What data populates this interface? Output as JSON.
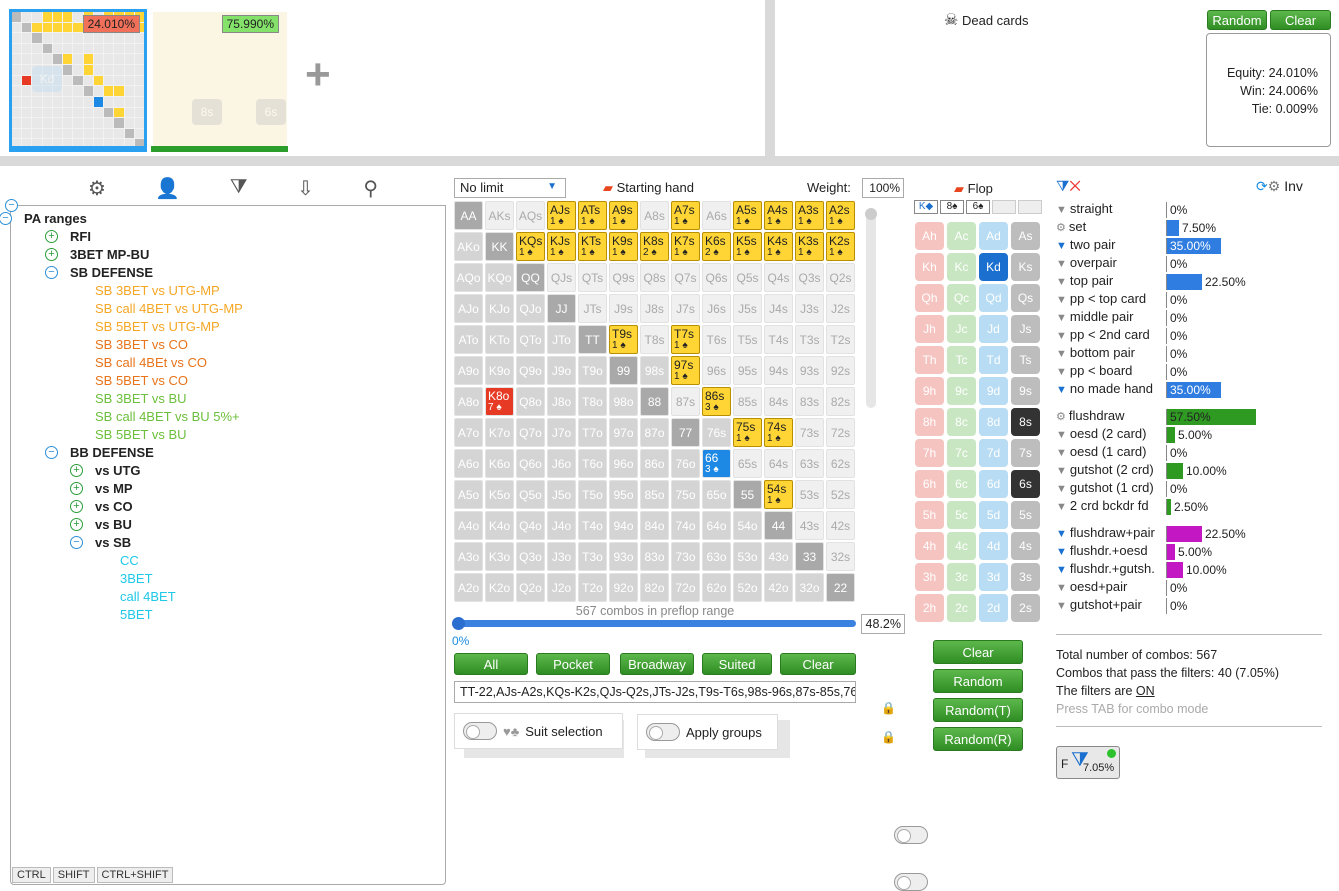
{
  "top": {
    "range_a_pct": "24.010%",
    "range_b_pct": "75.990%",
    "plus_label": "+"
  },
  "dead": {
    "title": "Dead cards",
    "skull": "☠",
    "rows": [
      [
        "Ah",
        "Kh",
        "Qh",
        "Jh",
        "Th",
        "9h",
        "8h",
        "7h",
        "6h",
        "5h",
        "4h",
        "3h",
        "2h"
      ],
      [
        "Ac",
        "Kc",
        "Qc",
        "Jc",
        "Tc",
        "9c",
        "8c",
        "7c",
        "6c",
        "5c",
        "4c",
        "3c",
        "2c"
      ],
      [
        "Ad",
        "Kd",
        "Qd",
        "Jd",
        "Td",
        "9d",
        "8d",
        "7d",
        "6d",
        "5d",
        "4d",
        "3d",
        "2d"
      ],
      [
        "As",
        "Ks",
        "Qs",
        "Js",
        "Ts",
        "9s",
        "8s",
        "7s",
        "6s",
        "5s",
        "4s",
        "3s",
        "2s"
      ]
    ],
    "random": "Random",
    "clear": "Clear",
    "equity": "Equity: 24.010%",
    "win": "Win: 24.006%",
    "tie": "Tie: 0.009%"
  },
  "toolbar": {
    "icons": [
      "gear-icon",
      "user-icon",
      "filter-add-icon",
      "import-icon",
      "search-icon"
    ],
    "glyphs": [
      "⚙",
      "👤",
      "⧩",
      "⇩",
      "⚲"
    ]
  },
  "tree": {
    "root": "PA ranges",
    "items": [
      {
        "label": "RFI",
        "lvl": 1,
        "bold": true,
        "exp": "+",
        "color": "#222"
      },
      {
        "label": "3BET MP-BU",
        "lvl": 1,
        "bold": true,
        "exp": "+",
        "color": "#222"
      },
      {
        "label": "SB DEFENSE",
        "lvl": 1,
        "bold": true,
        "exp": "-",
        "color": "#222"
      },
      {
        "label": "SB 3BET vs UTG-MP",
        "lvl": 2,
        "color": "#f5a623"
      },
      {
        "label": "SB call 4BET vs UTG-MP",
        "lvl": 2,
        "color": "#f5a623"
      },
      {
        "label": "SB 5BET vs UTG-MP",
        "lvl": 2,
        "color": "#f5a623"
      },
      {
        "label": "SB 3BET vs CO",
        "lvl": 2,
        "color": "#e8731a"
      },
      {
        "label": "SB call 4BEt vs CO",
        "lvl": 2,
        "color": "#e8731a"
      },
      {
        "label": "SB 5BET vs CO",
        "lvl": 2,
        "color": "#e8731a"
      },
      {
        "label": "SB 3BET vs BU",
        "lvl": 2,
        "color": "#6cbf3a"
      },
      {
        "label": "SB call 4BET vs BU 5%+",
        "lvl": 2,
        "color": "#6cbf3a"
      },
      {
        "label": "SB 5BET vs BU",
        "lvl": 2,
        "color": "#6cbf3a"
      },
      {
        "label": "BB DEFENSE",
        "lvl": 1,
        "bold": true,
        "exp": "-",
        "color": "#222"
      },
      {
        "label": "vs UTG",
        "lvl": 2,
        "bold": true,
        "exp": "+",
        "color": "#222"
      },
      {
        "label": "vs MP",
        "lvl": 2,
        "bold": true,
        "exp": "+",
        "color": "#222"
      },
      {
        "label": "vs CO",
        "lvl": 2,
        "bold": true,
        "exp": "+",
        "color": "#222"
      },
      {
        "label": "vs BU",
        "lvl": 2,
        "bold": true,
        "exp": "+",
        "color": "#222"
      },
      {
        "label": "vs SB",
        "lvl": 2,
        "bold": true,
        "exp": "-",
        "color": "#222"
      },
      {
        "label": "CC",
        "lvl": 3,
        "color": "#1ec8e8"
      },
      {
        "label": "3BET",
        "lvl": 3,
        "color": "#1ec8e8"
      },
      {
        "label": "call 4BET",
        "lvl": 3,
        "color": "#1ec8e8"
      },
      {
        "label": "5BET",
        "lvl": 3,
        "color": "#1ec8e8"
      }
    ],
    "keys": [
      "CTRL",
      "SHIFT",
      "CTRL+SHIFT"
    ]
  },
  "matrix": {
    "mode": "No limit",
    "starting": "Starting hand",
    "weight_label": "Weight:",
    "weight": "100%",
    "grid": [
      [
        "AA",
        "AKs",
        "AQs",
        "AJs|1",
        "ATs|1",
        "A9s|1",
        "A8s",
        "A7s|1",
        "A6s",
        "A5s|1",
        "A4s|1",
        "A3s|1",
        "A2s|1"
      ],
      [
        "AKo",
        "KK",
        "KQs|1",
        "KJs|1",
        "KTs|1",
        "K9s|1",
        "K8s|2",
        "K7s|1",
        "K6s|2",
        "K5s|1",
        "K4s|1",
        "K3s|1",
        "K2s|1"
      ],
      [
        "AQo",
        "KQo",
        "QQ",
        "QJs",
        "QTs",
        "Q9s",
        "Q8s",
        "Q7s",
        "Q6s",
        "Q5s",
        "Q4s",
        "Q3s",
        "Q2s"
      ],
      [
        "AJo",
        "KJo",
        "QJo",
        "JJ",
        "JTs",
        "J9s",
        "J8s",
        "J7s",
        "J6s",
        "J5s",
        "J4s",
        "J3s",
        "J2s"
      ],
      [
        "ATo",
        "KTo",
        "QTo",
        "JTo",
        "TT",
        "T9s|1",
        "T8s",
        "T7s|1",
        "T6s",
        "T5s",
        "T4s",
        "T3s",
        "T2s"
      ],
      [
        "A9o",
        "K9o",
        "Q9o",
        "J9o",
        "T9o",
        "99",
        "98s",
        "97s|1",
        "96s",
        "95s",
        "94s",
        "93s",
        "92s"
      ],
      [
        "A8o",
        "K8o|7",
        "Q8o",
        "J8o",
        "T8o",
        "98o",
        "88",
        "87s",
        "86s|3",
        "85s",
        "84s",
        "83s",
        "82s"
      ],
      [
        "A7o",
        "K7o",
        "Q7o",
        "J7o",
        "T7o",
        "97o",
        "87o",
        "77",
        "76s",
        "75s|1",
        "74s|1",
        "73s",
        "72s"
      ],
      [
        "A6o",
        "K6o",
        "Q6o",
        "J6o",
        "T6o",
        "96o",
        "86o",
        "76o",
        "66|3",
        "65s",
        "64s",
        "63s",
        "62s"
      ],
      [
        "A5o",
        "K5o",
        "Q5o",
        "J5o",
        "T5o",
        "95o",
        "85o",
        "75o",
        "65o",
        "55",
        "54s|1",
        "53s",
        "52s"
      ],
      [
        "A4o",
        "K4o",
        "Q4o",
        "J4o",
        "T4o",
        "94o",
        "84o",
        "74o",
        "64o",
        "54o",
        "44",
        "43s",
        "42s"
      ],
      [
        "A3o",
        "K3o",
        "Q3o",
        "J3o",
        "T3o",
        "93o",
        "83o",
        "73o",
        "63o",
        "53o",
        "43o",
        "33",
        "32s"
      ],
      [
        "A2o",
        "K2o",
        "Q2o",
        "J2o",
        "T2o",
        "92o",
        "82o",
        "72o",
        "62o",
        "52o",
        "42o",
        "32o",
        "22"
      ]
    ],
    "combos": "567 combos in preflop range",
    "slider_min": "0%",
    "slider_val": "48.2%",
    "buttons": [
      "All",
      "Pocket",
      "Broadway",
      "Suited",
      "Clear"
    ],
    "range_text": "TT-22,AJs-A2s,KQs-K2s,QJs-Q2s,JTs-J2s,T9s-T6s,98s-96s,87s-85s,76",
    "suit_sel": "Suit selection",
    "apply_groups": "Apply groups"
  },
  "flop": {
    "title": "Flop",
    "cards": [
      "K",
      "8",
      "6"
    ],
    "rows": [
      [
        "Ah",
        "Ac",
        "Ad",
        "As"
      ],
      [
        "Kh",
        "Kc",
        "Kd",
        "Ks"
      ],
      [
        "Qh",
        "Qc",
        "Qd",
        "Qs"
      ],
      [
        "Jh",
        "Jc",
        "Jd",
        "Js"
      ],
      [
        "Th",
        "Tc",
        "Td",
        "Ts"
      ],
      [
        "9h",
        "9c",
        "9d",
        "9s"
      ],
      [
        "8h",
        "8c",
        "8d",
        "8s"
      ],
      [
        "7h",
        "7c",
        "7d",
        "7s"
      ],
      [
        "6h",
        "6c",
        "6d",
        "6s"
      ],
      [
        "5h",
        "5c",
        "5d",
        "5s"
      ],
      [
        "4h",
        "4c",
        "4d",
        "4s"
      ],
      [
        "3h",
        "3c",
        "3d",
        "3s"
      ],
      [
        "2h",
        "2c",
        "2d",
        "2s"
      ]
    ],
    "clear": "Clear",
    "random": "Random",
    "random_t": "Random(T)",
    "random_r": "Random(R)"
  },
  "filters": {
    "inv": "Inv",
    "made": [
      {
        "l": "straight",
        "v": "0%",
        "f": 0
      },
      {
        "l": "set",
        "v": "7.50%",
        "f": 0.075
      },
      {
        "l": "two pair",
        "v": "35.00%",
        "f": 0.35,
        "sel": true
      },
      {
        "l": "overpair",
        "v": "0%",
        "f": 0
      },
      {
        "l": "top pair",
        "v": "22.50%",
        "f": 0.225
      },
      {
        "l": "pp < top card",
        "v": "0%",
        "f": 0
      },
      {
        "l": "middle pair",
        "v": "0%",
        "f": 0
      },
      {
        "l": "pp < 2nd card",
        "v": "0%",
        "f": 0
      },
      {
        "l": "bottom pair",
        "v": "0%",
        "f": 0
      },
      {
        "l": "pp < board",
        "v": "0%",
        "f": 0
      },
      {
        "l": "no made hand",
        "v": "35.00%",
        "f": 0.35,
        "sel": true
      }
    ],
    "draws": [
      {
        "l": "flushdraw",
        "v": "57.50%",
        "f": 0.575
      },
      {
        "l": "oesd (2 card)",
        "v": "5.00%",
        "f": 0.05
      },
      {
        "l": "oesd (1 card)",
        "v": "0%",
        "f": 0
      },
      {
        "l": "gutshot (2 crd)",
        "v": "10.00%",
        "f": 0.1
      },
      {
        "l": "gutshot (1 crd)",
        "v": "0%",
        "f": 0
      },
      {
        "l": "2 crd bckdr fd",
        "v": "2.50%",
        "f": 0.025
      }
    ],
    "combo": [
      {
        "l": "flushdraw+pair",
        "v": "22.50%",
        "f": 0.225,
        "sel": true
      },
      {
        "l": "flushdr.+oesd",
        "v": "5.00%",
        "f": 0.05,
        "sel": true
      },
      {
        "l": "flushdr.+gutsh.",
        "v": "10.00%",
        "f": 0.1,
        "sel": true
      },
      {
        "l": "oesd+pair",
        "v": "0%",
        "f": 0
      },
      {
        "l": "gutshot+pair",
        "v": "0%",
        "f": 0
      }
    ],
    "total": "Total number of combos: 567",
    "pass": "Combos that pass the filters: 40 (7.05%)",
    "filters_are": "The filters are",
    "on": "ON",
    "press_tab": "Press TAB for combo mode",
    "badge": "7.05%",
    "badge_f": "F"
  }
}
